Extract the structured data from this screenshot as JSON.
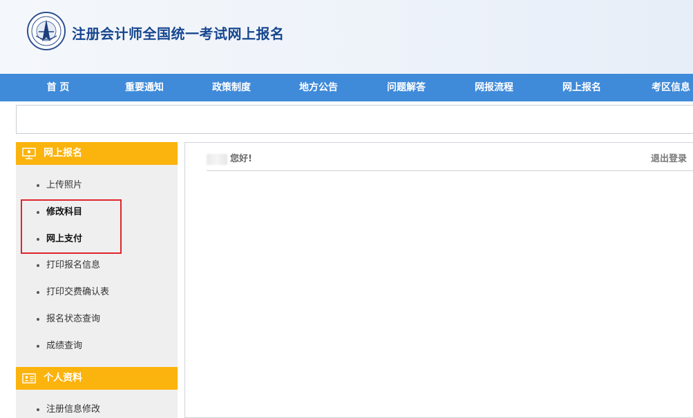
{
  "header": {
    "site_title": "注册会计师全国统一考试网上报名"
  },
  "nav": {
    "items": [
      "首 页",
      "重要通知",
      "政策制度",
      "地方公告",
      "问题解答",
      "网报流程",
      "网上报名",
      "考区信息"
    ]
  },
  "sidebar": {
    "section_online": "网上报名",
    "online_items": [
      "上传照片",
      "修改科目",
      "网上支付",
      "打印报名信息",
      "打印交费确认表",
      "报名状态查询",
      "成绩查询"
    ],
    "section_profile": "个人资料",
    "profile_items": [
      "注册信息修改"
    ]
  },
  "main": {
    "greeting": "您好!",
    "logout_label": "退出登录"
  },
  "colors": {
    "nav_bg": "#3f8ad9",
    "title": "#17468f",
    "section_header": "#fbb30d",
    "highlight": "#e0232b"
  }
}
